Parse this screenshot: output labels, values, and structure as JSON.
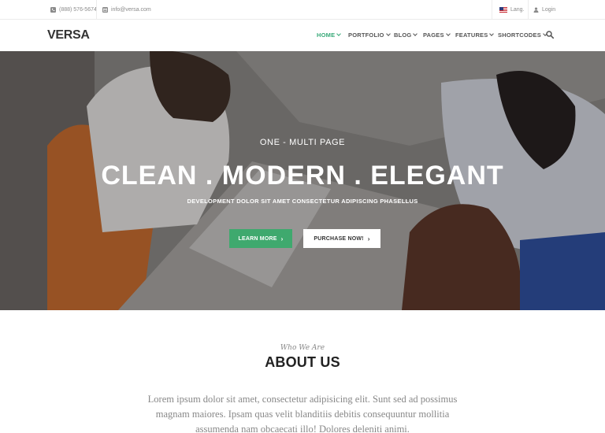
{
  "topbar": {
    "phone": "(888) 576-5674",
    "email": "info@versa.com",
    "lang": "Lang.",
    "login": "Login"
  },
  "header": {
    "logo": "VERSA",
    "nav": [
      {
        "label": "HOME",
        "active": true
      },
      {
        "label": "PORTFOLIO",
        "active": false
      },
      {
        "label": "BLOG",
        "active": false
      },
      {
        "label": "PAGES",
        "active": false
      },
      {
        "label": "FEATURES",
        "active": false
      },
      {
        "label": "SHORTCODES",
        "active": false
      }
    ],
    "search_icon": "search-icon"
  },
  "hero": {
    "subtitle": "ONE - MULTI PAGE",
    "title": "CLEAN . MODERN . ELEGANT",
    "description": "DEVELOPMENT DOLOR SIT AMET CONSECTETUR ADIPISCING PHASELLUS",
    "learn_more": "LEARN MORE",
    "purchase": "PURCHASE NOW!"
  },
  "about": {
    "kicker": "Who We Are",
    "title": "ABOUT US",
    "text": "Lorem ipsum dolor sit amet, consectetur adipisicing elit. Sunt sed ad possimus magnam maiores. Ipsam quas velit blanditiis debitis consequuntur mollitia assumenda nam obcaecati illo! Dolores deleniti animi."
  },
  "colors": {
    "accent": "#37a978",
    "button_green": "#3fa96e"
  }
}
